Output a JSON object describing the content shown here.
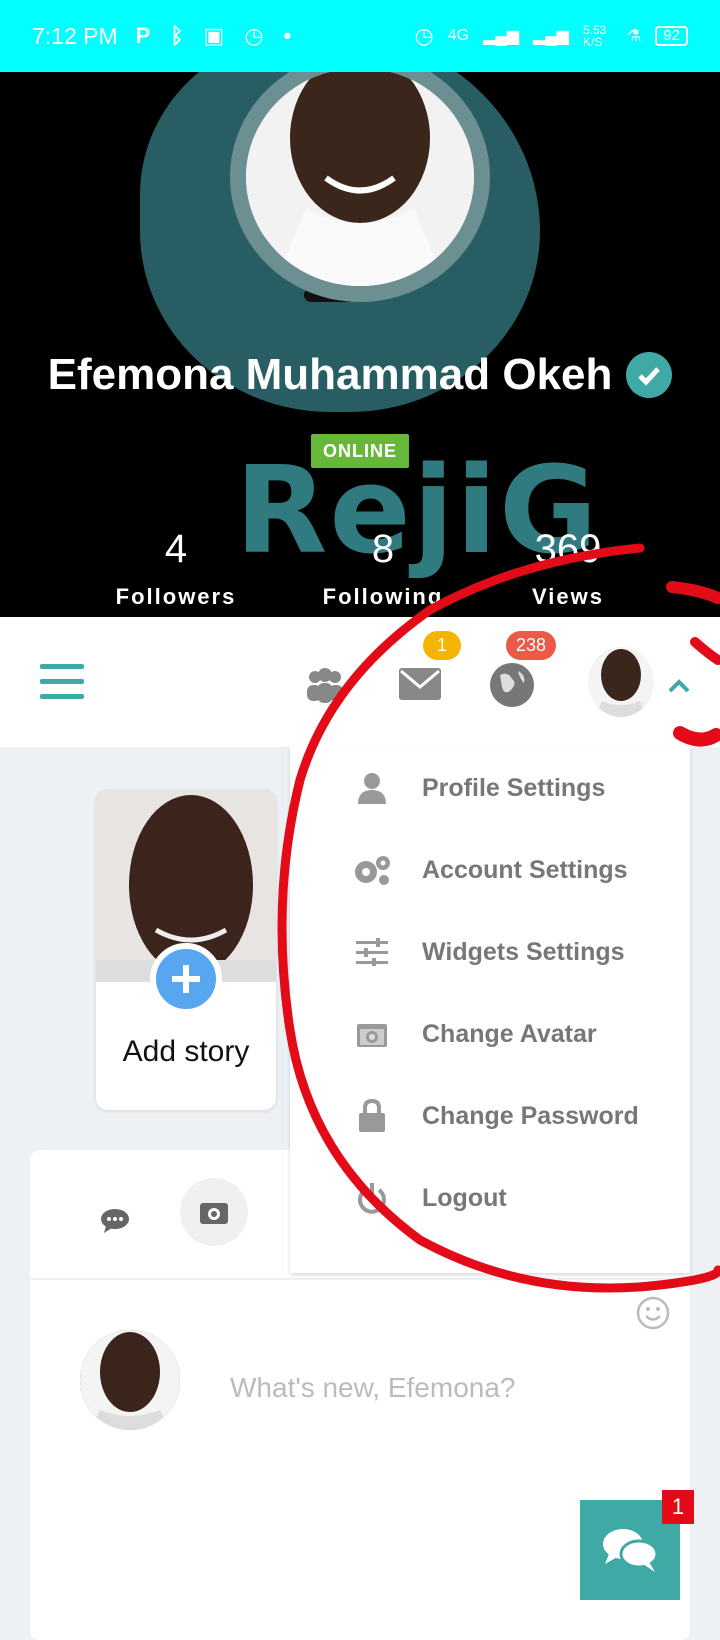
{
  "status_bar": {
    "time": "7:12 PM",
    "network_speed": "5.53 K/S",
    "network_type": "4G",
    "battery": "92"
  },
  "profile": {
    "name": "Efemona Muhammad Okeh",
    "status_badge": "ONLINE",
    "background_logo": "RejiG",
    "stats": [
      {
        "value": "4",
        "label": "Followers"
      },
      {
        "value": "8",
        "label": "Following"
      },
      {
        "value": "369",
        "label": "Views"
      }
    ]
  },
  "topbar": {
    "messages_badge": "1",
    "notifications_badge": "238"
  },
  "dropdown": {
    "items": [
      {
        "label": "Profile Settings",
        "icon": "user-icon"
      },
      {
        "label": "Account Settings",
        "icon": "gears-icon"
      },
      {
        "label": "Widgets Settings",
        "icon": "sliders-icon"
      },
      {
        "label": "Change Avatar",
        "icon": "camera-icon"
      },
      {
        "label": "Change Password",
        "icon": "lock-icon"
      },
      {
        "label": "Logout",
        "icon": "power-icon"
      }
    ]
  },
  "story": {
    "label": "Add story"
  },
  "composer": {
    "placeholder": "What's new, Efemona?"
  },
  "chat": {
    "badge": "1"
  },
  "colors": {
    "accent": "#3fa9a5",
    "status_bar": "#00ffff",
    "online": "#67b83a",
    "annotation": "#e30b17"
  }
}
